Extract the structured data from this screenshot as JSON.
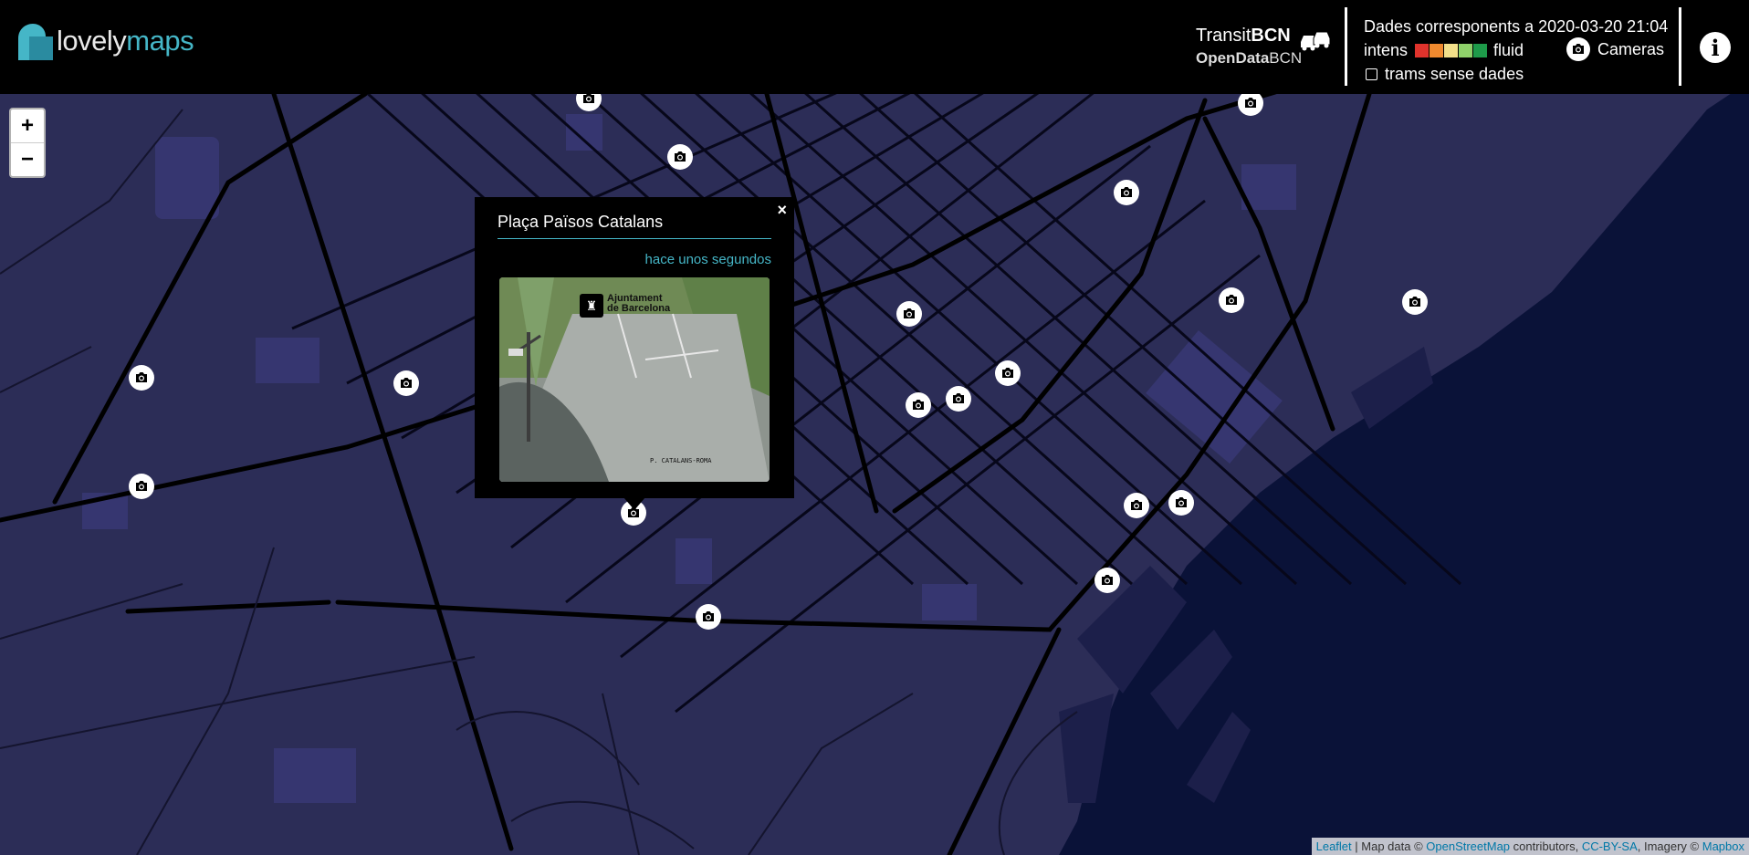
{
  "header": {
    "logo": {
      "part1": "lovely",
      "part2": "maps"
    },
    "transit": {
      "transit_label": "Transit",
      "bcn_label": "BCN",
      "opendata_label": "OpenData",
      "opendata_bcn": "BCN"
    },
    "data_timestamp": "Dades corresponents a 2020-03-20 21:04",
    "legend": {
      "intense_label": "intens",
      "fluid_label": "fluid",
      "colors": [
        "#e0332c",
        "#f08a2f",
        "#f3e08a",
        "#8fd16a",
        "#1e9b4a"
      ]
    },
    "no_data_label": "trams sense dades",
    "cameras_label": "Cameras",
    "info_glyph": "i"
  },
  "zoom": {
    "in_label": "+",
    "out_label": "−"
  },
  "popup": {
    "title": "Plaça Països Catalans",
    "time": "hace unos segundos",
    "close_label": "×",
    "camera_caption": "P. CATALANS-ROMA",
    "camera_logo_line1": "Ajuntament",
    "camera_logo_line2": "de Barcelona"
  },
  "map": {
    "background": "#2c2d57",
    "sea_color": "#0a1238",
    "road_color": "#07071a",
    "camera_markers": 22
  },
  "attribution": {
    "leaflet": "Leaflet",
    "sep1": " | Map data © ",
    "osm": "OpenStreetMap",
    "contrib": " contributors, ",
    "license": "CC-BY-SA",
    "imagery": ", Imagery © ",
    "mapbox": "Mapbox"
  }
}
